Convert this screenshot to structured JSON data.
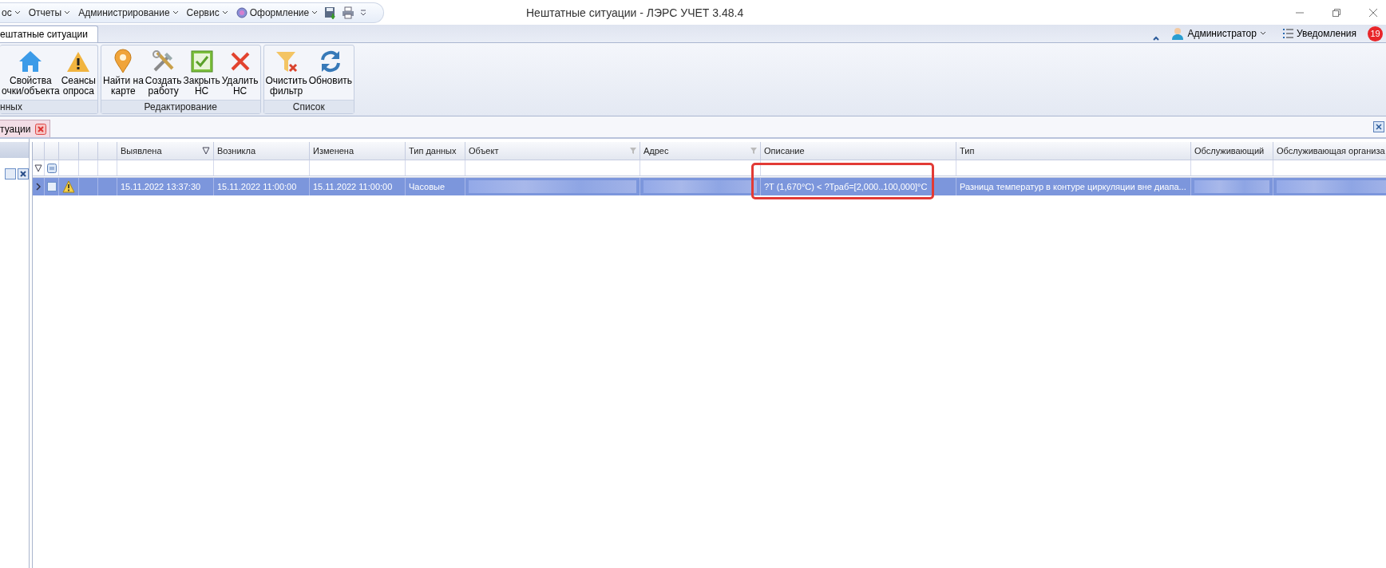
{
  "window": {
    "title": "Нештатные ситуации - ЛЭРС УЧЕТ 3.48.4"
  },
  "menu": [
    {
      "label": "ос"
    },
    {
      "label": "Отчеты"
    },
    {
      "label": "Администрирование"
    },
    {
      "label": "Сервис"
    },
    {
      "label": "Оформление",
      "kind": "theme"
    }
  ],
  "ribbon_tabs": [
    {
      "label": "ештатные ситуации",
      "selected": true
    }
  ],
  "user": {
    "name": "Администратор"
  },
  "notifications": {
    "label": "Уведомления",
    "count": "19"
  },
  "ribbon_groups": [
    {
      "label": "нных",
      "buttons": [
        {
          "lines": [
            "Свойства",
            "очки/объекта"
          ],
          "kind": "house"
        },
        {
          "lines": [
            "Сеансы",
            "опроса"
          ],
          "kind": "warning"
        }
      ]
    },
    {
      "label": "Редактирование",
      "buttons": [
        {
          "lines": [
            "Найти на",
            "карте"
          ],
          "kind": "pin"
        },
        {
          "lines": [
            "Создать",
            "работу"
          ],
          "kind": "tools"
        },
        {
          "lines": [
            "Закрыть",
            "НС"
          ],
          "kind": "check"
        },
        {
          "lines": [
            "Удалить",
            "НС"
          ],
          "kind": "cross"
        }
      ]
    },
    {
      "label": "Список",
      "buttons": [
        {
          "lines": [
            "Очистить",
            "фильтр"
          ],
          "kind": "funnel"
        },
        {
          "lines": [
            "Обновить"
          ],
          "kind": "refresh"
        }
      ]
    }
  ],
  "document_tabs": [
    {
      "label": "туации",
      "selected": true
    }
  ],
  "grid": {
    "columns": [
      {
        "label": "Выявлена",
        "sorted": true,
        "filtered": false
      },
      {
        "label": "Возникла",
        "sorted": false,
        "filtered": false
      },
      {
        "label": "Изменена",
        "sorted": false,
        "filtered": false
      },
      {
        "label": "Тип данных",
        "sorted": false,
        "filtered": false
      },
      {
        "label": "Объект",
        "sorted": false,
        "filtered": true
      },
      {
        "label": "Адрес",
        "sorted": false,
        "filtered": true
      },
      {
        "label": "Описание",
        "sorted": false,
        "filtered": false
      },
      {
        "label": "Тип",
        "sorted": false,
        "filtered": false
      },
      {
        "label": "Обслуживающий",
        "sorted": false,
        "filtered": false
      },
      {
        "label": "Обслуживающая организа"
      }
    ],
    "rows": [
      {
        "selected": true,
        "warning": true,
        "cells": [
          {
            "kind": "text",
            "text": "15.11.2022 13:37:30"
          },
          {
            "kind": "text",
            "text": "15.11.2022 11:00:00"
          },
          {
            "kind": "text",
            "text": "15.11.2022 11:00:00"
          },
          {
            "kind": "text",
            "text": "Часовые"
          },
          {
            "kind": "blurred"
          },
          {
            "kind": "blurred"
          },
          {
            "kind": "text",
            "text": "?T (1,670°C) < ?Траб=[2,000..100,000]°C",
            "highlighted": true
          },
          {
            "kind": "text",
            "text": "Разница температур в контуре циркуляции вне диапа..."
          },
          {
            "kind": "blurred"
          },
          {
            "kind": "blurred"
          }
        ]
      }
    ]
  }
}
